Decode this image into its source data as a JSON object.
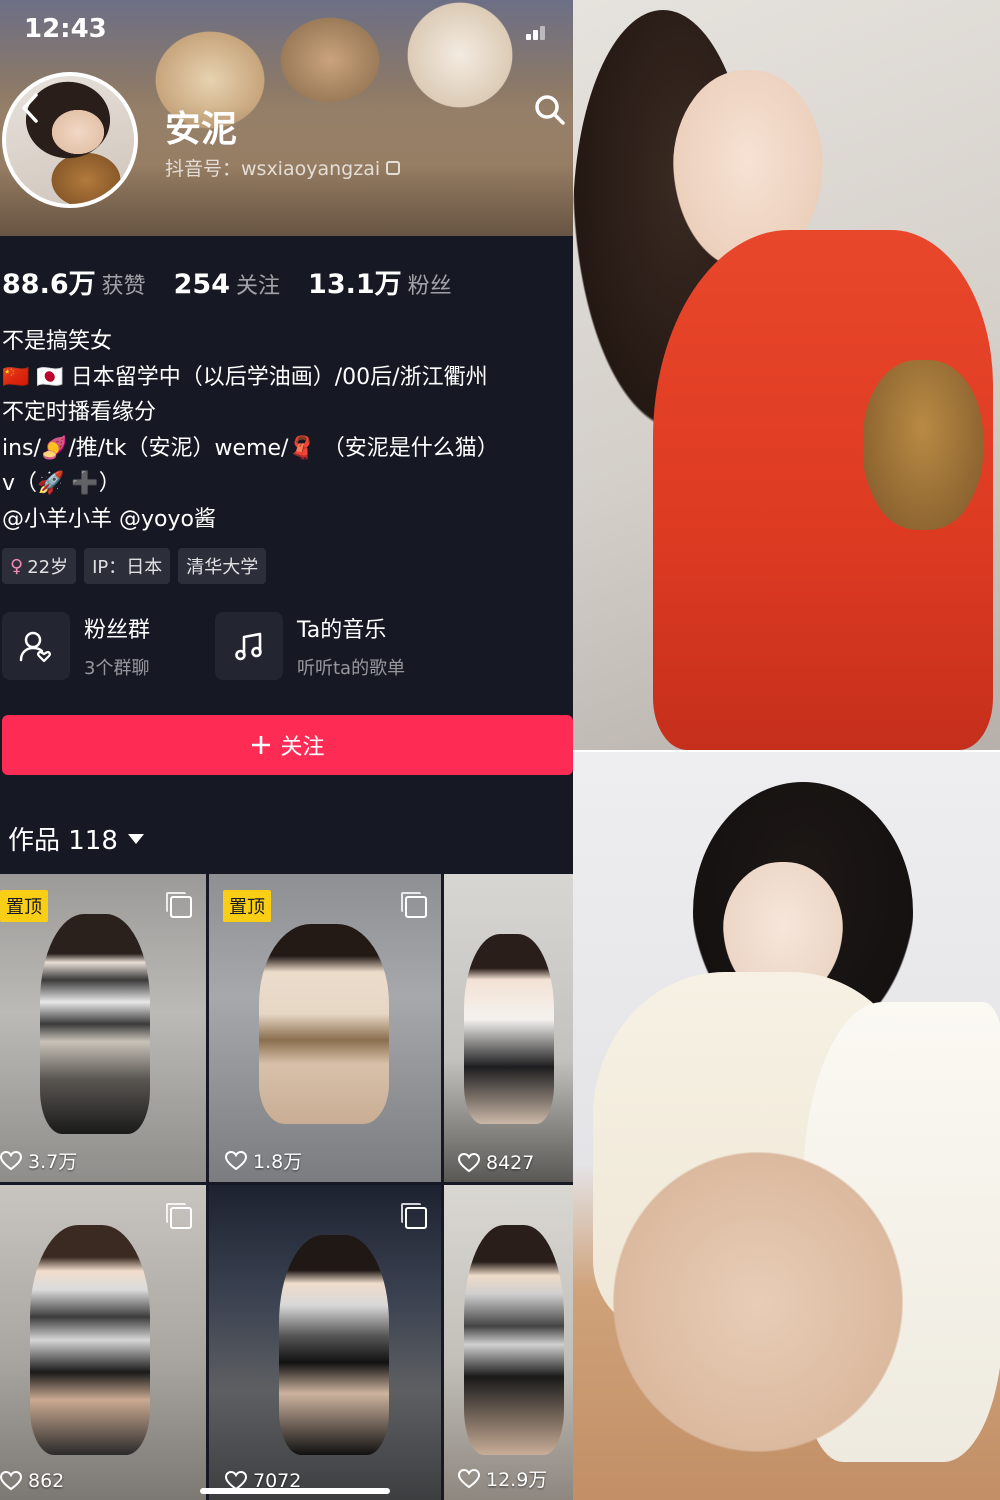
{
  "status_bar": {
    "time": "12:43"
  },
  "profile": {
    "name": "安泥",
    "id_line": "抖音号：wsxiaoyangzai"
  },
  "stats": [
    {
      "value": "88.6万",
      "label": "获赞"
    },
    {
      "value": "254",
      "label": "关注"
    },
    {
      "value": "13.1万",
      "label": "粉丝"
    }
  ],
  "bio": [
    "不是搞笑女",
    "🇨🇳 🇯🇵 日本留学中（以后学油画）/00后/浙江衢州",
    "不定时播看缘分",
    "ins/🍠/推/tk（安泥）weme/🧣 （安泥是什么猫）",
    "v（🚀 ➕）",
    "@小羊小羊 @yoyo酱"
  ],
  "tags": [
    {
      "label": "22岁",
      "icon": "female-icon"
    },
    {
      "label": "IP：日本"
    },
    {
      "label": "清华大学"
    }
  ],
  "features": [
    {
      "title": "粉丝群",
      "subtitle": "3个群聊",
      "icon": "fans-group-icon"
    },
    {
      "title": "Ta的音乐",
      "subtitle": "听听ta的歌单",
      "icon": "music-note-icon"
    }
  ],
  "follow_button": {
    "label": "关注"
  },
  "works": {
    "label": "作品 118"
  },
  "videos": [
    {
      "likes": "3.7万",
      "pinned": "置顶",
      "multi": true
    },
    {
      "likes": "1.8万",
      "pinned": "置顶",
      "multi": true
    },
    {
      "likes": "8427"
    },
    {
      "likes": "862",
      "multi": true
    },
    {
      "likes": "7072",
      "multi": true
    },
    {
      "likes": "12.9万"
    }
  ],
  "colors": {
    "background": "#161823",
    "accent": "#fe2c55",
    "pinned_badge": "#face15"
  }
}
